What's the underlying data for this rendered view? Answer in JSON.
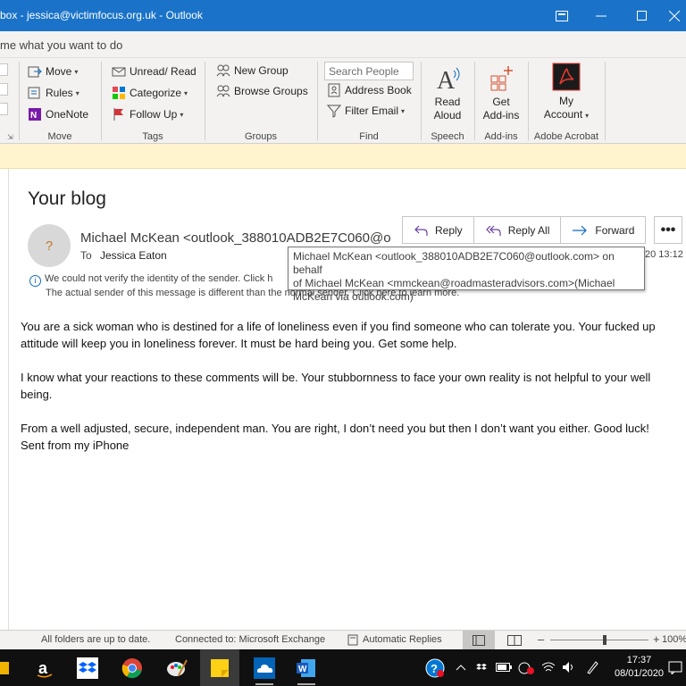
{
  "window": {
    "title": "box - jessica@victimfocus.org.uk  -  Outlook"
  },
  "tell_me": "me what you want to do",
  "ribbon": {
    "move_group": {
      "move": "Move",
      "rules": "Rules",
      "onenote": "OneNote",
      "label": "Move"
    },
    "tags_group": {
      "unread_read": "Unread/ Read",
      "categorize": "Categorize",
      "follow_up": "Follow Up",
      "label": "Tags"
    },
    "groups_group": {
      "new_group": "New Group",
      "browse_groups": "Browse Groups",
      "label": "Groups"
    },
    "find_group": {
      "search_placeholder": "Search People",
      "address_book": "Address Book",
      "filter_email": "Filter Email",
      "label": "Find"
    },
    "speech_group": {
      "read_aloud_1": "Read",
      "read_aloud_2": "Aloud",
      "label": "Speech"
    },
    "addins_group": {
      "get_addins_1": "Get",
      "get_addins_2": "Add-ins",
      "label": "Add-ins"
    },
    "acrobat_group": {
      "my_account_1": "My",
      "my_account_2": "Account",
      "label": "Adobe Acrobat"
    }
  },
  "message": {
    "subject": "Your blog",
    "avatar_initial": "?",
    "sender": "Michael McKean <outlook_388010ADB2E7C060@o",
    "to_label": "To",
    "to_name": "Jessica Eaton",
    "datetime": "20 13:12",
    "actions": {
      "reply": "Reply",
      "reply_all": "Reply All",
      "forward": "Forward",
      "more": "•••"
    },
    "warning_line1": "We could not verify the identity of the sender. Click h",
    "warning_line2": "The actual sender of this message is different than the normal sender. Click here to learn more.",
    "tooltip_line1": "Michael McKean <outlook_388010ADB2E7C060@outlook.com>  on behalf",
    "tooltip_line2": "of Michael McKean <mmckean@roadmasteradvisors.com>(Michael",
    "tooltip_line3": "McKean via outlook.com)",
    "body": [
      "You are a sick woman who is destined for a life of loneliness even if you find someone who can tolerate you.  Your fucked up attitude will keep you in loneliness forever.  It must be hard being you.  Get some help.",
      "I know what your reactions to these comments will be.  Your stubbornness to face your own reality is not helpful to your well being.",
      "From a well adjusted, secure, independent man.  You are right, I don’t need you but then I don’t want you either.  Good luck!",
      "Sent from my iPhone"
    ]
  },
  "status": {
    "folders": "All folders are up to date.",
    "connection": "Connected to: Microsoft Exchange",
    "auto_replies": "Automatic Replies",
    "zoom": "100%",
    "zoom_value": 0.55
  },
  "taskbar": {
    "time": "17:37",
    "date": "08/01/2020"
  },
  "colors": {
    "title_bar": "#1a73c8",
    "notice": "#fff4ce",
    "acrobat": "#b30b00"
  }
}
